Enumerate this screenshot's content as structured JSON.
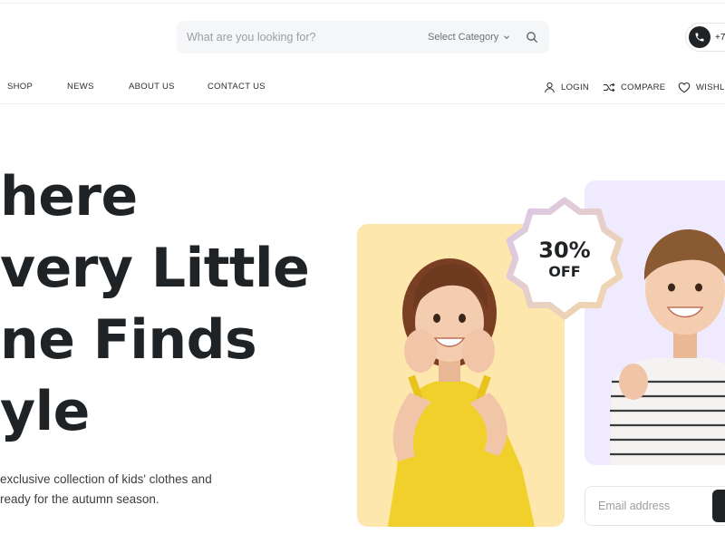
{
  "search": {
    "placeholder": "What are you looking for?",
    "category_label": "Select Category"
  },
  "header": {
    "phone": "+7:"
  },
  "nav": {
    "links": [
      "SHOP",
      "NEWS",
      "ABOUT US",
      "CONTACT US"
    ],
    "login": "LOGIN",
    "compare": "COMPARE",
    "wishlist": "WISHLI"
  },
  "hero": {
    "title_lines": [
      "here",
      "very Little",
      "ne Finds",
      "yle"
    ],
    "description_lines": [
      " exclusive collection of kids' clothes and",
      "ready for the autumn season."
    ]
  },
  "promo": {
    "percent": "30%",
    "off": "OFF",
    "colors": {
      "card_yellow": "#fde7ac",
      "card_lilac": "#efeafd",
      "badge_border_start": "#d9c6ec",
      "badge_border_end": "#f3d7a6"
    }
  },
  "newsletter": {
    "placeholder": "Email address"
  },
  "icons": [
    "chevron-down-icon",
    "search-icon",
    "phone-icon",
    "user-icon",
    "shuffle-icon",
    "heart-icon"
  ]
}
